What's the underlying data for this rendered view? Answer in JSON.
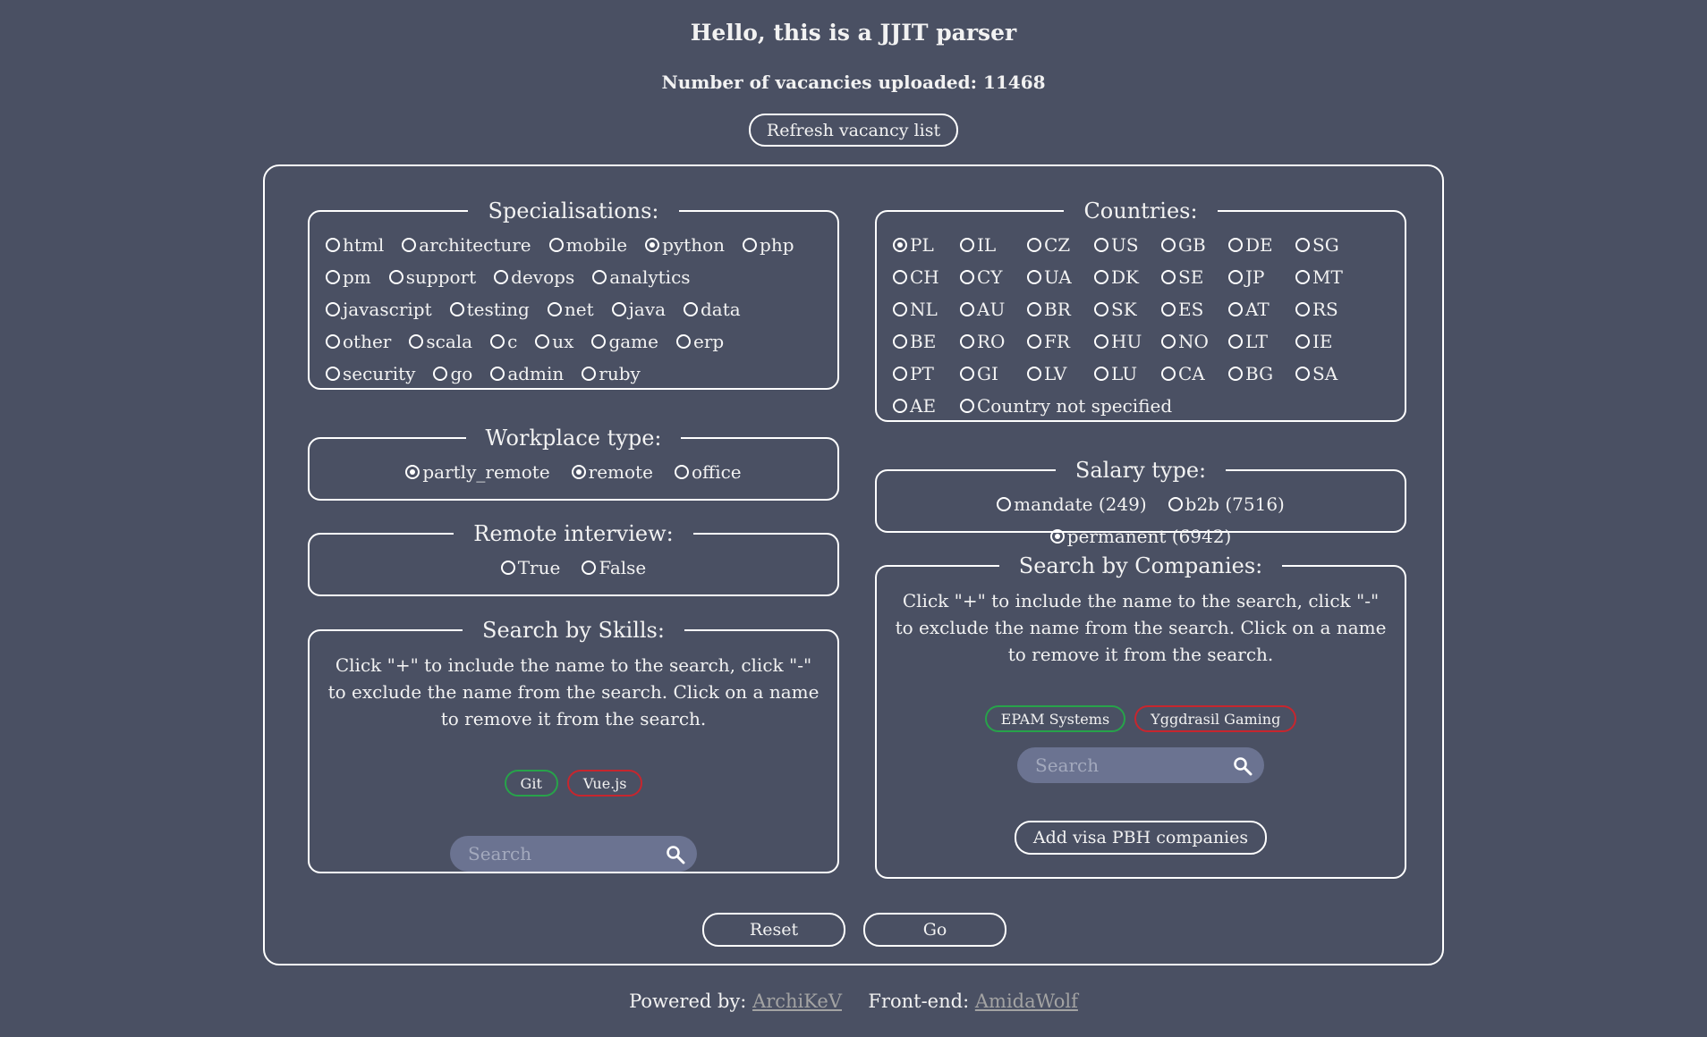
{
  "header": {
    "title": "Hello, this is a JJIT parser",
    "count_label": "Number of vacancies uploaded: 11468",
    "refresh_label": "Refresh vacancy list"
  },
  "specialisations": {
    "legend": "Specialisations:",
    "options": [
      {
        "label": "html",
        "selected": false
      },
      {
        "label": "architecture",
        "selected": false
      },
      {
        "label": "mobile",
        "selected": false
      },
      {
        "label": "python",
        "selected": true
      },
      {
        "label": "php",
        "selected": false
      },
      {
        "label": "pm",
        "selected": false
      },
      {
        "label": "support",
        "selected": false
      },
      {
        "label": "devops",
        "selected": false
      },
      {
        "label": "analytics",
        "selected": false
      },
      {
        "label": "javascript",
        "selected": false
      },
      {
        "label": "testing",
        "selected": false
      },
      {
        "label": "net",
        "selected": false
      },
      {
        "label": "java",
        "selected": false
      },
      {
        "label": "data",
        "selected": false
      },
      {
        "label": "other",
        "selected": false
      },
      {
        "label": "scala",
        "selected": false
      },
      {
        "label": "c",
        "selected": false
      },
      {
        "label": "ux",
        "selected": false
      },
      {
        "label": "game",
        "selected": false
      },
      {
        "label": "erp",
        "selected": false
      },
      {
        "label": "security",
        "selected": false
      },
      {
        "label": "go",
        "selected": false
      },
      {
        "label": "admin",
        "selected": false
      },
      {
        "label": "ruby",
        "selected": false
      }
    ]
  },
  "countries": {
    "legend": "Countries:",
    "options": [
      {
        "label": "PL",
        "selected": true
      },
      {
        "label": "IL",
        "selected": false
      },
      {
        "label": "CZ",
        "selected": false
      },
      {
        "label": "US",
        "selected": false
      },
      {
        "label": "GB",
        "selected": false
      },
      {
        "label": "DE",
        "selected": false
      },
      {
        "label": "SG",
        "selected": false
      },
      {
        "label": "CH",
        "selected": false
      },
      {
        "label": "CY",
        "selected": false
      },
      {
        "label": "UA",
        "selected": false
      },
      {
        "label": "DK",
        "selected": false
      },
      {
        "label": "SE",
        "selected": false
      },
      {
        "label": "JP",
        "selected": false
      },
      {
        "label": "MT",
        "selected": false
      },
      {
        "label": "NL",
        "selected": false
      },
      {
        "label": "AU",
        "selected": false
      },
      {
        "label": "BR",
        "selected": false
      },
      {
        "label": "SK",
        "selected": false
      },
      {
        "label": "ES",
        "selected": false
      },
      {
        "label": "AT",
        "selected": false
      },
      {
        "label": "RS",
        "selected": false
      },
      {
        "label": "BE",
        "selected": false
      },
      {
        "label": "RO",
        "selected": false
      },
      {
        "label": "FR",
        "selected": false
      },
      {
        "label": "HU",
        "selected": false
      },
      {
        "label": "NO",
        "selected": false
      },
      {
        "label": "LT",
        "selected": false
      },
      {
        "label": "IE",
        "selected": false
      },
      {
        "label": "PT",
        "selected": false
      },
      {
        "label": "GI",
        "selected": false
      },
      {
        "label": "LV",
        "selected": false
      },
      {
        "label": "LU",
        "selected": false
      },
      {
        "label": "CA",
        "selected": false
      },
      {
        "label": "BG",
        "selected": false
      },
      {
        "label": "SA",
        "selected": false
      },
      {
        "label": "AE",
        "selected": false
      },
      {
        "label": "Country not specified",
        "selected": false
      }
    ]
  },
  "workplace": {
    "legend": "Workplace type:",
    "options": [
      {
        "label": "partly_remote",
        "selected": true
      },
      {
        "label": "remote",
        "selected": true
      },
      {
        "label": "office",
        "selected": false
      }
    ]
  },
  "salary": {
    "legend": "Salary type:",
    "options": [
      {
        "label": "mandate (249)",
        "selected": false
      },
      {
        "label": "b2b (7516)",
        "selected": false
      },
      {
        "label": "permanent (6942)",
        "selected": true
      }
    ]
  },
  "remote_interview": {
    "legend": "Remote interview:",
    "options": [
      {
        "label": "True",
        "selected": false
      },
      {
        "label": "False",
        "selected": false
      }
    ]
  },
  "skills": {
    "legend": "Search by Skills:",
    "note": "Click \"+\" to include the name to the search, click \"-\" to exclude the name from the search. Click on a name to remove it from the search.",
    "tags": [
      {
        "label": "Git",
        "type": "include"
      },
      {
        "label": "Vue.js",
        "type": "exclude"
      }
    ],
    "search_placeholder": "Search"
  },
  "companies": {
    "legend": "Search by Companies:",
    "note": "Click \"+\" to include the name to the search, click \"-\" to exclude the name from the search. Click on a name to remove it from the search.",
    "tags": [
      {
        "label": "EPAM Systems",
        "type": "include"
      },
      {
        "label": "Yggdrasil Gaming",
        "type": "exclude"
      }
    ],
    "search_placeholder": "Search",
    "visa_label": "Add visa PBH companies"
  },
  "actions": {
    "reset_label": "Reset",
    "go_label": "Go"
  },
  "footer": {
    "powered_label": "Powered by:",
    "powered_name": "ArchiKeV",
    "frontend_label": "Front-end:",
    "frontend_name": "AmidaWolf"
  },
  "colors": {
    "background": "#4a5063",
    "include_tag": "#27a34a",
    "exclude_tag": "#c7262e",
    "search_bg": "#6b7391"
  }
}
